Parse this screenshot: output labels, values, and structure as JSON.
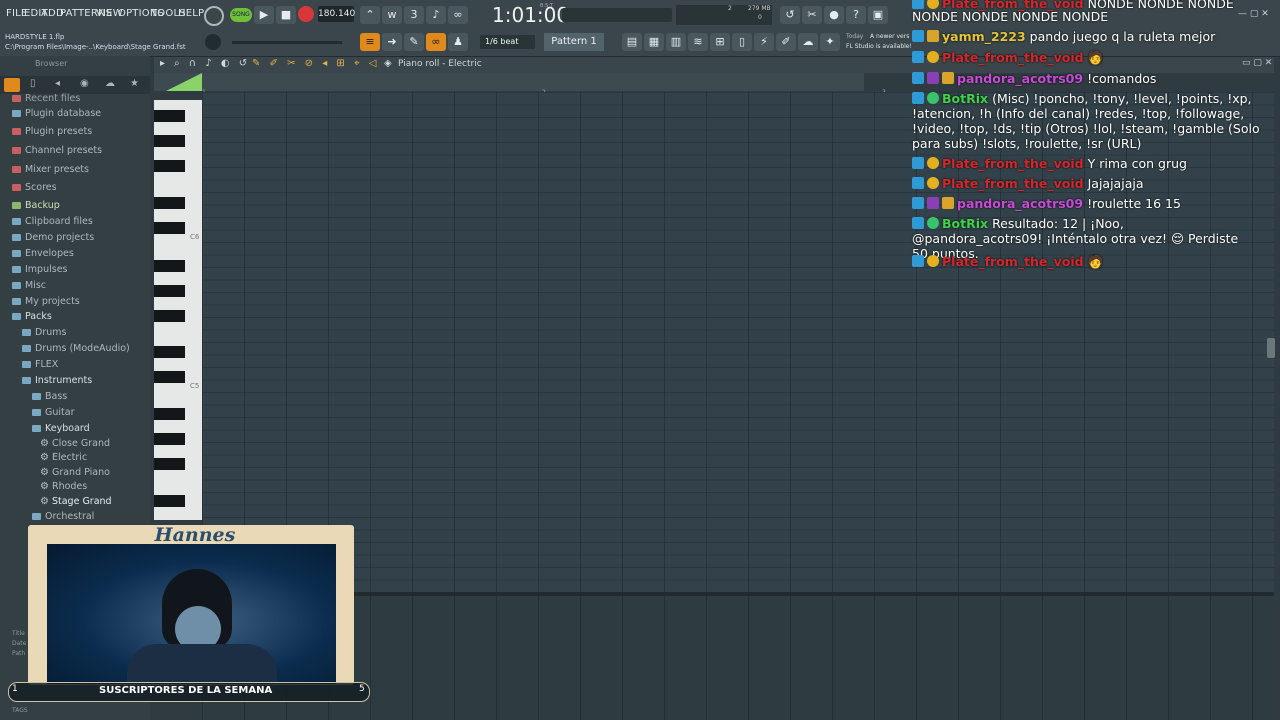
{
  "menu": [
    "FILE",
    "EDIT",
    "ADD",
    "PATTERNS",
    "VIEW",
    "OPTIONS",
    "TOOLS",
    "HELP"
  ],
  "transport": {
    "tempo": "180.140",
    "song_label": "SONG",
    "time": "1:01:00",
    "time_sub": "B:S:T",
    "memory": "279 MB",
    "cpu": "2",
    "poly": "0"
  },
  "project": {
    "name": "HARDSTYLE 1.flp",
    "path": "C:\\Program Files\\Image-..\\Keyboard\\Stage Grand.fst"
  },
  "snap": "1/6 beat",
  "pattern": "Pattern 1",
  "hint": {
    "line1": "Today",
    "line2": "A newer vers",
    "line3": "FL Studio is available!"
  },
  "browser": {
    "title": "Browser",
    "items": [
      {
        "label": "Recent files",
        "type": "folder-red"
      },
      {
        "label": "Plugin database",
        "type": "plugin"
      },
      {
        "label": "Plugin presets",
        "type": "folder-red"
      },
      {
        "label": "Channel presets",
        "type": "folder-red"
      },
      {
        "label": "Mixer presets",
        "type": "folder-red"
      },
      {
        "label": "Scores",
        "type": "folder-red"
      },
      {
        "label": "Backup",
        "type": "folder-green"
      },
      {
        "label": "Clipboard files",
        "type": "folder"
      },
      {
        "label": "Demo projects",
        "type": "folder"
      },
      {
        "label": "Envelopes",
        "type": "folder"
      },
      {
        "label": "Impulses",
        "type": "folder"
      },
      {
        "label": "Misc",
        "type": "folder"
      },
      {
        "label": "My projects",
        "type": "folder"
      },
      {
        "label": "Packs",
        "type": "folder"
      },
      {
        "label": "Drums",
        "type": "folder"
      },
      {
        "label": "Drums (ModeAudio)",
        "type": "folder"
      },
      {
        "label": "FLEX",
        "type": "folder"
      },
      {
        "label": "Instruments",
        "type": "folder"
      },
      {
        "label": "Bass",
        "type": "folder"
      },
      {
        "label": "Guitar",
        "type": "folder"
      },
      {
        "label": "Keyboard",
        "type": "folder"
      },
      {
        "label": "Close Grand",
        "type": "preset"
      },
      {
        "label": "Electric",
        "type": "preset"
      },
      {
        "label": "Grand Piano",
        "type": "preset"
      },
      {
        "label": "Rhodes",
        "type": "preset"
      },
      {
        "label": "Stage Grand",
        "type": "preset"
      },
      {
        "label": "Orchestral",
        "type": "folder"
      }
    ],
    "bottom": [
      "Title",
      "Date",
      "Path",
      "TAGS"
    ]
  },
  "piano_roll": {
    "title": "Piano roll - Electric",
    "octaves": [
      "C6",
      "C5"
    ],
    "bars": [
      "1",
      "2",
      "3"
    ]
  },
  "chat": [
    {
      "user": "Plate_from_the_void",
      "msg": "NONDE NONDE NONDE",
      "color": "#d2272b"
    },
    {
      "user": "",
      "msg": "NONDE NONDE NONDE NONDE",
      "color": "#ffffff"
    },
    {
      "user": "yamm_2223",
      "msg": "pando juego q la ruleta mejor",
      "color": "#e4c53a"
    },
    {
      "user": "Plate_from_the_void",
      "msg": "🧑",
      "color": "#d2272b"
    },
    {
      "user": "pandora_acotrs09",
      "msg": "!comandos",
      "color": "#c74bd6"
    },
    {
      "user": "BotRix",
      "msg": "(Misc) !poncho, !tony, !level, !points, !xp, !atencion, !h (Info del canal) !redes, !top, !followage, !video, !top, !ds, !tip (Otros) !lol, !steam, !gamble (Solo para subs) !slots, !roulette, !sr (URL)",
      "color": "#3fd24a"
    },
    {
      "user": "Plate_from_the_void",
      "msg": "Y rima con grug",
      "color": "#d2272b"
    },
    {
      "user": "Plate_from_the_void",
      "msg": "Jajajajaja",
      "color": "#d2272b"
    },
    {
      "user": "pandora_acotrs09",
      "msg": "!roulette 16 15",
      "color": "#c74bd6"
    },
    {
      "user": "BotRix",
      "msg": "Resultado: 12 | ¡Noo, @pandora_acotrs09! ¡Inténtalo otra vez! 😌 Perdiste 50 puntos.",
      "color": "#3fd24a"
    },
    {
      "user": "Plate_from_the_void",
      "msg": "🧑",
      "color": "#d2272b"
    }
  ],
  "webcam": {
    "name": "Hannes",
    "banner": "SUSCRIPTORES DE LA SEMANA",
    "left_count": "1",
    "right_count": "5"
  }
}
